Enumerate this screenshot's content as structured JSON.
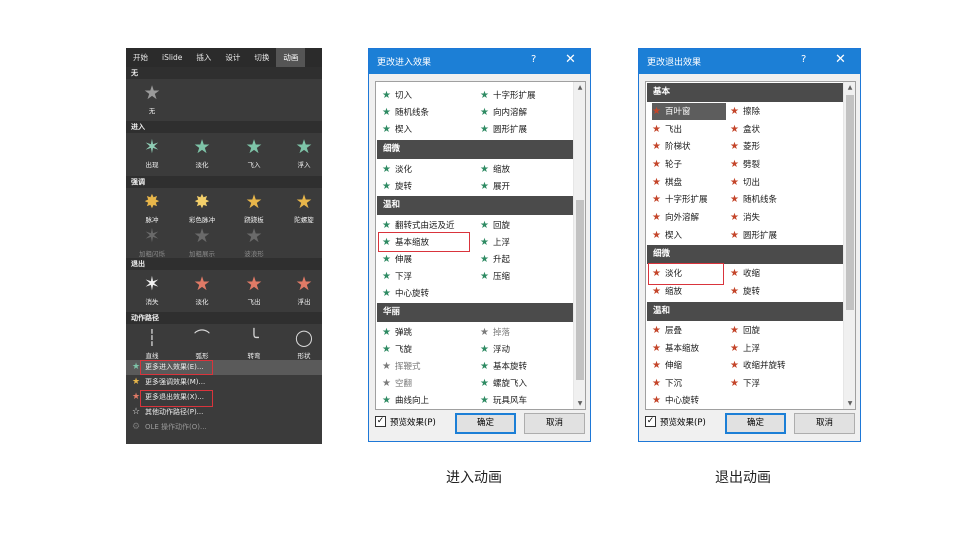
{
  "gallery": {
    "tabs": [
      "开始",
      "iSlide",
      "插入",
      "设计",
      "切换",
      "动画"
    ],
    "sections": {
      "none": "无",
      "entrance": "进入",
      "emphasis": "强调",
      "exit": "退出",
      "paths": "动作路径"
    },
    "none_item": "无",
    "entrance_items": [
      "出现",
      "淡化",
      "飞入",
      "浮入"
    ],
    "emphasis_row1": [
      "脉冲",
      "彩色脉冲",
      "跷跷板",
      "陀螺旋"
    ],
    "emphasis_row2": [
      "加粗闪烁",
      "加粗展示",
      "波浪形"
    ],
    "exit_items": [
      "消失",
      "淡化",
      "飞出",
      "浮出"
    ],
    "path_items": [
      "直线",
      "弧形",
      "转弯",
      "形状"
    ],
    "menu": [
      "更多进入效果(E)...",
      "更多强调效果(M)...",
      "更多退出效果(X)...",
      "其他动作路径(P)...",
      "OLE 操作动作(O)..."
    ]
  },
  "entrance_dialog": {
    "title": "更改进入效果",
    "help": "?",
    "close": "✕",
    "basic_items": [
      [
        "切入",
        "十字形扩展"
      ],
      [
        "随机线条",
        "向内溶解"
      ],
      [
        "楔入",
        "圆形扩展"
      ]
    ],
    "subtle_header": "细微",
    "subtle_items": [
      [
        "淡化",
        "缩放"
      ],
      [
        "旋转",
        "展开"
      ]
    ],
    "moderate_header": "温和",
    "moderate_items": [
      [
        "翻转式由远及近",
        "回旋"
      ],
      [
        "基本缩放",
        "上浮"
      ],
      [
        "伸展",
        "升起"
      ],
      [
        "下浮",
        "压缩"
      ],
      [
        "中心旋转",
        ""
      ]
    ],
    "exciting_header": "华丽",
    "exciting_items": [
      [
        "弹跳",
        "掉落"
      ],
      [
        "飞旋",
        "浮动"
      ],
      [
        "挥鞭式",
        "基本旋转"
      ],
      [
        "空翻",
        "螺旋飞入"
      ],
      [
        "曲线向上",
        "玩具风车"
      ]
    ],
    "preview": "预览效果(P)",
    "ok": "确定",
    "cancel": "取消"
  },
  "exit_dialog": {
    "title": "更改退出效果",
    "help": "?",
    "close": "✕",
    "basic_header": "基本",
    "basic_items": [
      [
        "百叶窗",
        "擦除"
      ],
      [
        "飞出",
        "盒状"
      ],
      [
        "阶梯状",
        "菱形"
      ],
      [
        "轮子",
        "劈裂"
      ],
      [
        "棋盘",
        "切出"
      ],
      [
        "十字形扩展",
        "随机线条"
      ],
      [
        "向外溶解",
        "消失"
      ],
      [
        "楔入",
        "圆形扩展"
      ]
    ],
    "subtle_header": "细微",
    "subtle_items": [
      [
        "淡化",
        "收缩"
      ],
      [
        "缩放",
        "旋转"
      ]
    ],
    "moderate_header": "温和",
    "moderate_items": [
      [
        "层叠",
        "回旋"
      ],
      [
        "基本缩放",
        "上浮"
      ],
      [
        "伸缩",
        "收缩并旋转"
      ],
      [
        "下沉",
        "下浮"
      ],
      [
        "中心旋转",
        ""
      ]
    ],
    "preview": "预览效果(P)",
    "ok": "确定",
    "cancel": "取消"
  },
  "captions": {
    "entrance": "进入动画",
    "exit": "退出动画"
  },
  "colors": {
    "entrance_star": "#2f8b63",
    "exit_star": "#c4452a",
    "highlight_box": "#d9343c",
    "title_bar": "#1c7fd6"
  }
}
